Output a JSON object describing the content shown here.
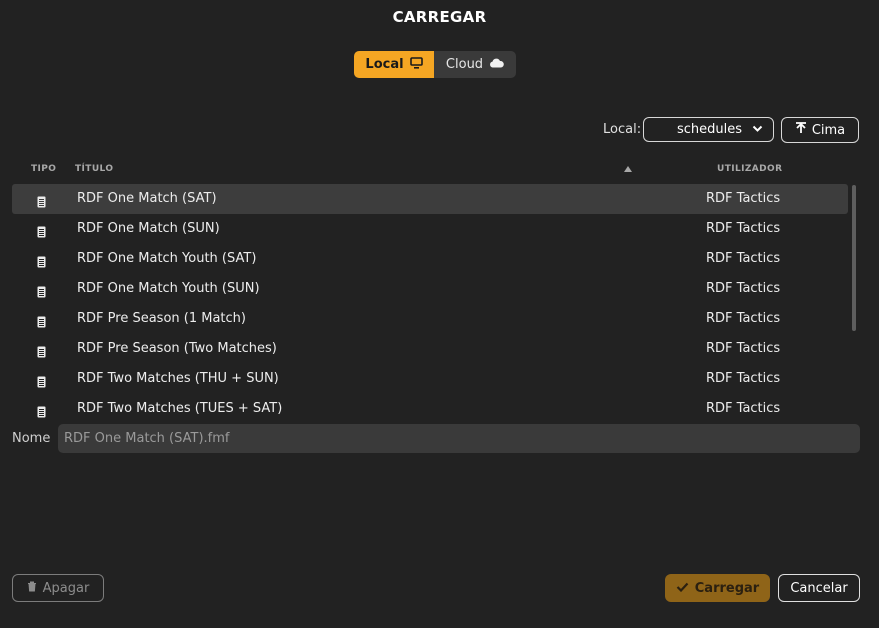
{
  "dialog": {
    "title": "CARREGAR"
  },
  "source_tabs": [
    {
      "label": "Local",
      "icon": "monitor-icon",
      "active": true
    },
    {
      "label": "Cloud",
      "icon": "cloud-icon",
      "active": false
    }
  ],
  "location": {
    "label": "Local:",
    "selected": "schedules",
    "up_label": "Cima"
  },
  "columns": {
    "type": "TIPO",
    "title": "TÍTULO",
    "user": "UTILIZADOR",
    "sort": "ascending"
  },
  "files": [
    {
      "title": "RDF One Match (SAT)",
      "user": "RDF Tactics",
      "icon": "document-icon",
      "selected": true
    },
    {
      "title": "RDF One Match (SUN)",
      "user": "RDF Tactics",
      "icon": "document-icon"
    },
    {
      "title": "RDF One Match Youth (SAT)",
      "user": "RDF Tactics",
      "icon": "document-icon"
    },
    {
      "title": "RDF One Match Youth (SUN)",
      "user": "RDF Tactics",
      "icon": "document-icon"
    },
    {
      "title": "RDF Pre Season (1 Match)",
      "user": "RDF Tactics",
      "icon": "document-icon"
    },
    {
      "title": "RDF Pre Season (Two Matches)",
      "user": "RDF Tactics",
      "icon": "document-icon"
    },
    {
      "title": "RDF Two Matches (THU + SUN)",
      "user": "RDF Tactics",
      "icon": "document-icon"
    },
    {
      "title": "RDF Two Matches (TUES + SAT)",
      "user": "RDF Tactics",
      "icon": "document-icon"
    }
  ],
  "filename": {
    "label": "Nome",
    "value": "RDF One Match (SAT).fmf"
  },
  "actions": {
    "delete_label": "Apagar",
    "load_label": "Carregar",
    "cancel_label": "Cancelar"
  },
  "colors": {
    "accent": "#f5a623",
    "background": "#222222",
    "selected_row": "#3d3d3d",
    "load_button": "#8f6418"
  }
}
